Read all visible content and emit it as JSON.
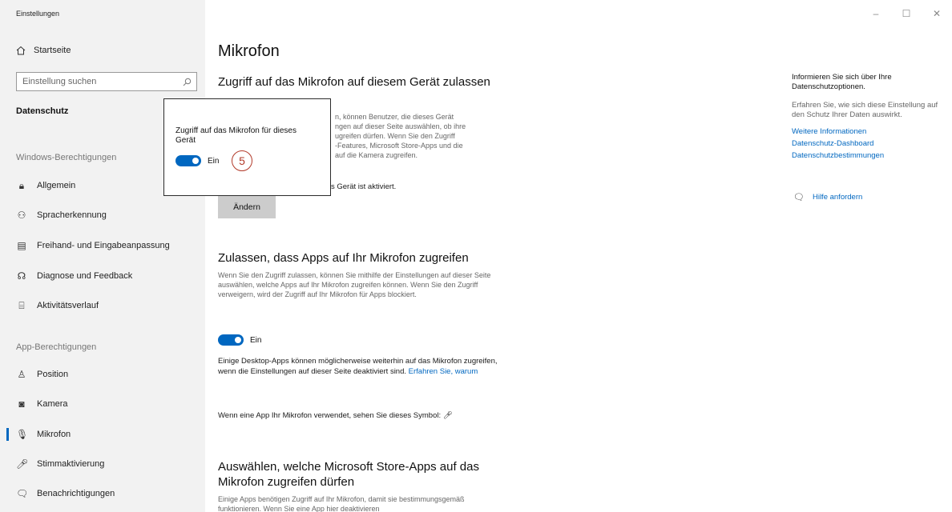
{
  "window": {
    "title": "Einstellungen",
    "minimize_glyph": "–",
    "maximize_glyph": "☐",
    "close_glyph": "✕"
  },
  "sidebar": {
    "home": {
      "icon": "home-icon",
      "label": "Startseite"
    },
    "search": {
      "placeholder": "Einstellung suchen",
      "icon": "search-icon"
    },
    "section_title": "Datenschutz",
    "windows_group_label": "Windows-Berechtigungen",
    "windows_items": [
      {
        "icon": "lock-icon",
        "label": "Allgemein"
      },
      {
        "icon": "speech-icon",
        "label": "Spracherkennung"
      },
      {
        "icon": "notepad-icon",
        "label": "Freihand- und Eingabeanpassung"
      },
      {
        "icon": "feedback-icon",
        "label": "Diagnose und Feedback"
      },
      {
        "icon": "timeline-icon",
        "label": "Aktivitätsverlauf"
      }
    ],
    "app_group_label": "App-Berechtigungen",
    "app_items": [
      {
        "icon": "location-icon",
        "label": "Position"
      },
      {
        "icon": "camera-icon",
        "label": "Kamera"
      },
      {
        "icon": "microphone-icon",
        "label": "Mikrofon",
        "active": true
      },
      {
        "icon": "voice-activation-icon",
        "label": "Stimmaktivierung"
      },
      {
        "icon": "notifications-icon",
        "label": "Benachrichtigungen"
      }
    ]
  },
  "main": {
    "page_title": "Mikrofon",
    "device_section": {
      "heading": "Zugriff auf das Mikrofon auf diesem Gerät zulassen",
      "desc_visible_lines": [
        "n, können Benutzer, die dieses Gerät",
        "ngen auf dieser Seite auswählen, ob ihre",
        "ugreifen dürfen. Wenn Sie den Zugriff",
        "-Features, Microsoft Store-Apps und die",
        "auf die Kamera zugreifen."
      ],
      "status_visible": "s Gerät ist aktiviert.",
      "change_button": "Ändern"
    },
    "apps_section": {
      "heading": "Zulassen, dass Apps auf Ihr Mikrofon zugreifen",
      "desc": "Wenn Sie den Zugriff zulassen, können Sie mithilfe der Einstellungen auf dieser Seite auswählen, welche Apps auf Ihr Mikrofon zugreifen können. Wenn Sie den Zugriff verweigern, wird der Zugriff auf Ihr Mikrofon für Apps blockiert.",
      "toggle_label": "Ein",
      "toggle_on": true,
      "note": "Einige Desktop-Apps können möglicherweise weiterhin auf das Mikrofon zugreifen, wenn die Einstellungen auf dieser Seite deaktiviert sind.",
      "note_link": "Erfahren Sie, warum",
      "symbol_text": "Wenn eine App Ihr Mikrofon verwendet, sehen Sie dieses Symbol:",
      "symbol_icon": "microphone-icon"
    },
    "store_section": {
      "heading": "Auswählen, welche Microsoft Store-Apps auf das Mikrofon zugreifen dürfen",
      "desc_partial": "Einige Apps benötigen Zugriff auf Ihr Mikrofon, damit sie bestimmungsgemäß funktionieren. Wenn Sie eine App hier deaktivieren"
    }
  },
  "popup": {
    "label": "Zugriff auf das Mikrofon für dieses Gerät",
    "toggle_label": "Ein",
    "toggle_on": true,
    "step_number": "5"
  },
  "right_panel": {
    "title": "Informieren Sie sich über Ihre Datenschutzoptionen.",
    "desc": "Erfahren Sie, wie sich diese Einstellung auf den Schutz Ihrer Daten auswirkt.",
    "links": [
      "Weitere Informationen",
      "Datenschutz-Dashboard",
      "Datenschutzbestimmungen"
    ],
    "help_icon": "help-chat-icon",
    "help_label": "Hilfe anfordern"
  },
  "colors": {
    "accent": "#0067c0",
    "sidebar_bg": "#f2f2f2",
    "step_circle": "#b23a2a"
  }
}
